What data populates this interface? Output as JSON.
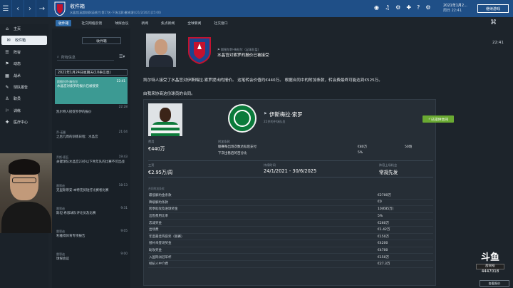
{
  "header": {
    "title": "收件箱",
    "subtitle": "水晶宫|英超联赛(英格兰)第17名-下场比赛:曼城(客)(21/2/2021|15:00)",
    "date_line1": "2021年1月2...",
    "date_line2": "周日 22:41",
    "continue_label": "继续游戏",
    "nav_back": "‹",
    "nav_fwd": "›",
    "nav_menu": "☰",
    "nav_arrow": "→"
  },
  "top_icons": [
    "◉",
    "♫",
    "⚙",
    "✚",
    "?",
    "⚙"
  ],
  "sidebar": {
    "items": [
      {
        "icon": "⌂",
        "label": "主页",
        "active": false
      },
      {
        "icon": "✉",
        "label": "收件箱",
        "active": true
      },
      {
        "icon": "☰",
        "label": "阵容",
        "active": false
      },
      {
        "icon": "⚑",
        "label": "动态",
        "active": false
      },
      {
        "icon": "▦",
        "label": "战术",
        "active": false
      },
      {
        "icon": "✎",
        "label": "球队报告",
        "active": false
      },
      {
        "icon": "♙",
        "label": "职员",
        "active": false
      },
      {
        "icon": "⚐",
        "label": "训练",
        "active": false
      },
      {
        "icon": "✚",
        "label": "医疗中心",
        "active": false
      }
    ]
  },
  "tabs": [
    "收件箱",
    "社交网络反馈",
    "球探会议",
    "新闻",
    "焦点新闻",
    "全球要闻",
    "社交窗口"
  ],
  "inbox": {
    "new_button": "收件箱",
    "search_placeholder": "所有信息",
    "date_header": "2021年1月24日星期天(10条信息)",
    "messages": [
      {
        "from": "斯图尔特·梅拉尔",
        "subject": "水晶宫对索罗的报价已被接受",
        "time": "22:41",
        "selected": true
      },
      {
        "from": "",
        "subject": "凯尔特人接受罗伊的报价",
        "time": "22:28",
        "selected": false
      },
      {
        "from": "乔·诺曼",
        "subject": "之后几周的训练日程：水晶宫",
        "time": "21:04",
        "selected": false
      },
      {
        "from": "乔斯·德瓦",
        "subject": "关键球队水晶宫23岁以下青年队的比赛不可出战",
        "time": "19:43",
        "selected": false
      },
      {
        "from": "雷恩迪",
        "subject": "克里斯蒂安·本特克剪短打比赛者比赛",
        "time": "18:13",
        "selected": false
      },
      {
        "from": "雷恩迪",
        "subject": "斯坦·希恩球队评论员及比赛",
        "time": "9:31",
        "selected": false
      },
      {
        "from": "雷恩迪",
        "subject": "利雅得体育专项报告",
        "time": "9:05",
        "selected": false
      },
      {
        "from": "雷恩迪",
        "subject": "球探会议",
        "time": "9:00",
        "selected": false
      }
    ]
  },
  "message": {
    "from_line": "斯图尔特·梅拉尔（足球总监）",
    "subject": "水晶宫对索罗的报价已被接受",
    "time": "22:41",
    "body1": "凯尔特人接受了水晶宫对伊斯梅拉·索罗提出的报价。 这笔转会价值约€440万。 根据合同中的附加条款，转会费最终可能达到€525万。",
    "body2": "由我来协商这份球员的合同。"
  },
  "player_card": {
    "name": "伊斯梅拉·索罗",
    "info": "22岁的中场队员",
    "button": "已提供合同",
    "fee_label": "费用",
    "fee_value": "€440万",
    "clause_label": "附加条款",
    "clause_rows": [
      {
        "label": "联赛每出场次数达标后支付",
        "amount": "€80万",
        "count": "50场"
      },
      {
        "label": "下次出售后的百分比",
        "amount": "5%",
        "count": ""
      }
    ],
    "wage_label": "工资",
    "wage_value": "€2.95万/周",
    "contract_label": "持续时间",
    "contract_value": "24/1/2021 - 30/6/2025",
    "squad_label": "阵容上场机会",
    "squad_value": "常规先发",
    "table_header": "合同附加条款",
    "rows": [
      {
        "label": "最低解约金条款",
        "value": "€2700万"
      },
      {
        "label": "降级解约条款",
        "value": "€0"
      },
      {
        "label": "跨季助攻及进球奖金",
        "value": "10(€85万)"
      },
      {
        "label": "出售费用比率",
        "value": "5%"
      },
      {
        "label": "忠诚奖金",
        "value": "€260万"
      },
      {
        "label": "出场费",
        "value": "€1.42万"
      },
      {
        "label": "年度最佳阵容奖（联赛）",
        "value": "€150万"
      },
      {
        "label": "替补未登场奖金",
        "value": "€4200"
      },
      {
        "label": "助攻奖金",
        "value": "€4700"
      },
      {
        "label": "入国际洲冠军杯",
        "value": "€150万"
      },
      {
        "label": "经纪人中介费",
        "value": "€27.3万"
      }
    ]
  },
  "watermark": {
    "brand": "斗鱼",
    "tag": "房间号",
    "room": "4447018"
  },
  "bottom_button": "查看报价",
  "colors": {
    "header_bg": "#1f4f87",
    "selected_message": "#3c9a93",
    "accent_button": "#6aaa32"
  }
}
